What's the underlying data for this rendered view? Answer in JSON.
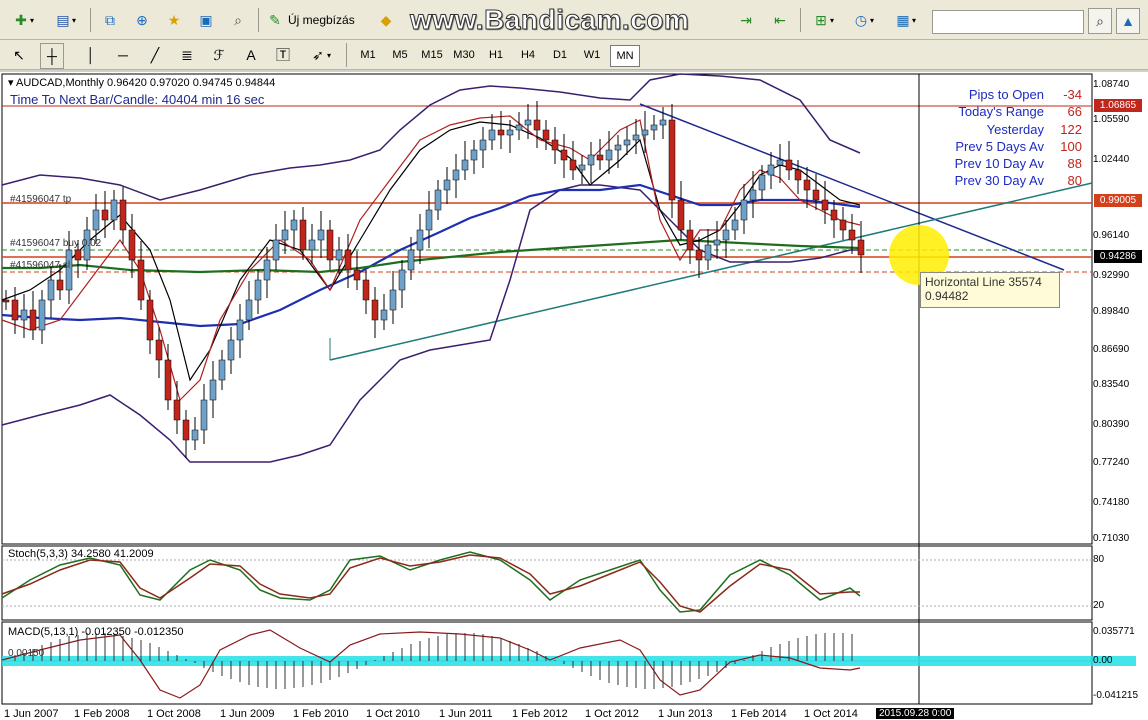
{
  "toolbar": {
    "new_order_label": "Új megbízás",
    "watermark": "www.Bandicam.com",
    "periods": [
      "M1",
      "M5",
      "M15",
      "M30",
      "H1",
      "H4",
      "D1",
      "W1",
      "MN"
    ],
    "active_period": "MN",
    "icons_row1": [
      "new-chart-icon",
      "profiles-icon",
      "market-watch-icon",
      "crosshair-icon",
      "favorites-icon",
      "data-window-icon",
      "zoom-icon",
      "new-order-icon",
      "expert-advisors-icon",
      "autotrading-icon",
      "chart-shift-icon",
      "zoom-in-icon",
      "period-clock-icon",
      "templates-icon"
    ],
    "icons_row2": [
      "cursor-icon",
      "crosshair-tool-icon",
      "vertical-line-icon",
      "horizontal-line-icon",
      "trendline-icon",
      "fibonacci-icon",
      "equidistant-channel-icon",
      "text-icon",
      "text-label-icon",
      "arrows-icon"
    ]
  },
  "chart": {
    "header": "AUDCAD,Monthly  0.96420 0.97020 0.94745 0.94844",
    "next_bar": "Time To Next Bar/Candle: 40404 min 16 sec",
    "info": [
      {
        "label": "Pips to Open",
        "value": "-34"
      },
      {
        "label": "Today's Range",
        "value": "66"
      },
      {
        "label": "Yesterday",
        "value": "122"
      },
      {
        "label": "Prev 5 Days Av",
        "value": "100"
      },
      {
        "label": "Prev 10 Day Av",
        "value": "88"
      },
      {
        "label": "Prev 30 Day Av",
        "value": "80"
      }
    ],
    "orders": {
      "tp": "#41596047 tp",
      "buy": "#41596047 buy 0.02",
      "sl": "#41596047 sl"
    },
    "tooltip_line1": "Horizontal Line 35574",
    "tooltip_line2": "0.94482",
    "price_axis": [
      "1.08740",
      "1.05590",
      "1.02440",
      "0.96140",
      "0.92990",
      "0.89840",
      "0.86690",
      "0.83540",
      "0.80390",
      "0.77240",
      "0.74180",
      "0.71030"
    ],
    "tags": [
      {
        "value": "1.06865",
        "color": "#c0261c"
      },
      {
        "value": "0.99005",
        "color": "#d4401c"
      },
      {
        "value": "0.94286",
        "color": "#000000"
      }
    ]
  },
  "stoch": {
    "header": "Stoch(5,3,3) 34.2580 41.2009",
    "levels": [
      "80",
      "20"
    ]
  },
  "macd": {
    "header": "MACD(5,13,1) -0.012350 -0.012350",
    "axis": [
      "0.035771",
      "0.00",
      "-0.041215"
    ],
    "overlay": "0.00150"
  },
  "x_axis": [
    "1 Jun 2007",
    "1 Feb 2008",
    "1 Oct 2008",
    "1 Jun 2009",
    "1 Feb 2010",
    "1 Oct 2010",
    "1 Jun 2011",
    "1 Feb 2012",
    "1 Oct 2012",
    "1 Jun 2013",
    "1 Feb 2014",
    "1 Oct 2014"
  ],
  "x_cursor_label": "2015.09.28 0:00"
}
